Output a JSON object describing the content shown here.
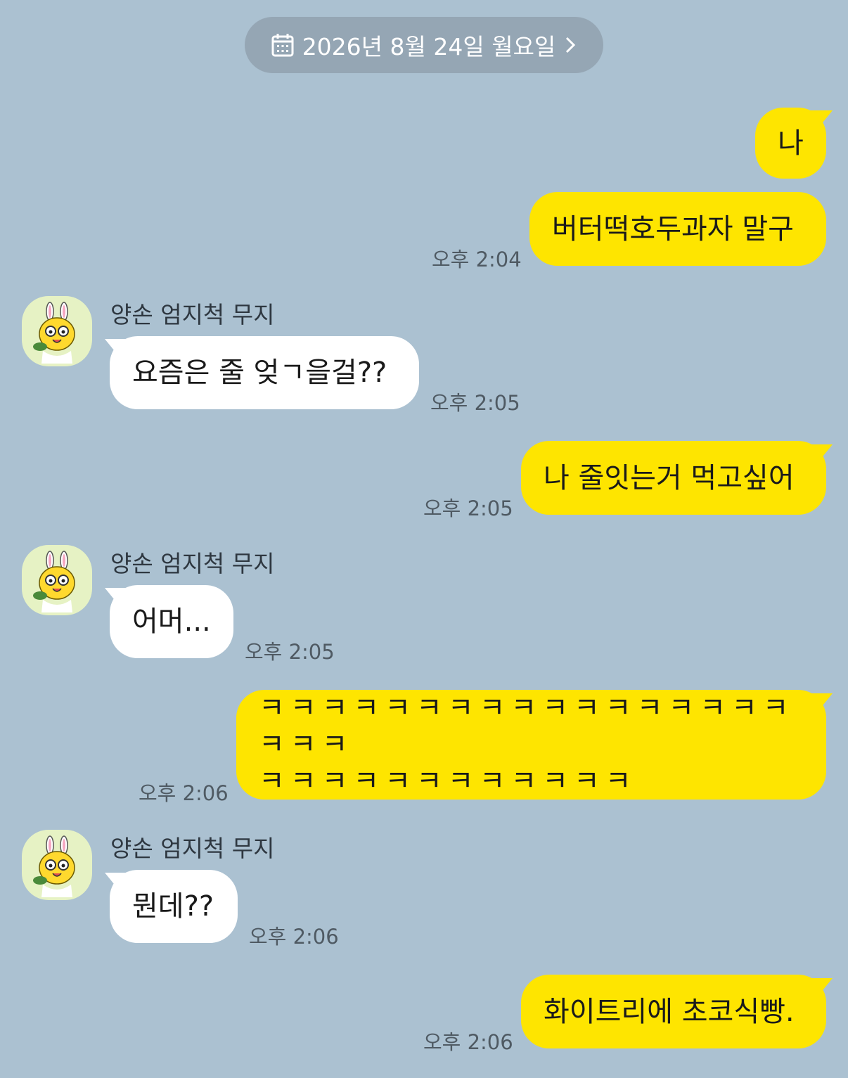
{
  "date_divider": {
    "label": "2026년 8월 24일 월요일",
    "icon": "calendar-icon",
    "chevron": "chevron-right-icon"
  },
  "sender_name": "양손 엄지척 무지",
  "colors": {
    "background": "#abc1d1",
    "my_bubble": "#fee500",
    "their_bubble": "#ffffff"
  },
  "messages": [
    {
      "from": "me",
      "text": "나",
      "time": ""
    },
    {
      "from": "me",
      "text": "버터떡호두과자 말구",
      "time": "오후 2:04"
    },
    {
      "from": "them",
      "text": "요즘은 줄 엊ㄱ을걸??",
      "time": "오후 2:05"
    },
    {
      "from": "me",
      "text": "나 줄잇는거 먹고싶어",
      "time": "오후 2:05"
    },
    {
      "from": "them",
      "text": "어머...",
      "time": "오후 2:05"
    },
    {
      "from": "me",
      "lines": [
        "ㅋㅋㅋㅋㅋㅋㅋㅋㅋㅋㅋㅋㅋㅋㅋㅋㅋㅋㅋㅋ",
        "ㅋㅋㅋㅋㅋㅋㅋㅋㅋㅋㅋㅋ"
      ],
      "time": "오후 2:06"
    },
    {
      "from": "them",
      "text": "뭔데??",
      "time": "오후 2:06"
    },
    {
      "from": "me",
      "text": "화이트리에 초코식빵.",
      "time": "오후 2:06"
    }
  ]
}
